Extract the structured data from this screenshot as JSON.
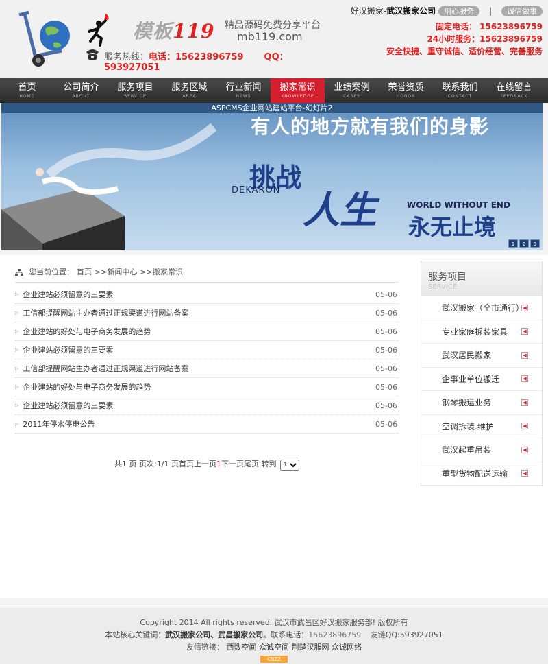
{
  "header": {
    "brand_text": "模板",
    "brand_num": "119",
    "tagline": "精品源码免费分享平台",
    "url_text": "mb119.com",
    "hotline_label": "服务热线：",
    "hotline_tel": "电话：15623896759",
    "hotline_qq": "QQ：593927051",
    "top_company_plain": "好汉搬家-",
    "top_company_bold": "武汉搬家公司",
    "pill_1": "用心服务",
    "pill_2": "诚信做事",
    "phone_fixed": "固定电话：  15623896759",
    "phone_24h": "24小时服务：15623896759",
    "motto": "安全快捷、重守诚信、适价经营、完善服务"
  },
  "nav": [
    {
      "cn": "首页",
      "en": "HOME"
    },
    {
      "cn": "公司简介",
      "en": "ABOUT"
    },
    {
      "cn": "服务项目",
      "en": "SERVICE"
    },
    {
      "cn": "服务区域",
      "en": "AREA"
    },
    {
      "cn": "行业新闻",
      "en": "NEWS"
    },
    {
      "cn": "搬家常识",
      "en": "KNOWLEDGE"
    },
    {
      "cn": "业绩案例",
      "en": "CASES"
    },
    {
      "cn": "荣誉资质",
      "en": "HONOR"
    },
    {
      "cn": "联系我们",
      "en": "CONTACT"
    },
    {
      "cn": "在线留言",
      "en": "FEEDBACK"
    }
  ],
  "banner": {
    "title": "ASPCMS企业网站建站平台-幻灯片2",
    "slogan": "有人的地方就有我们的身影",
    "tiaozhan": "挑战",
    "dekaron": "DEKARON",
    "rensheng": "人生",
    "wwe": "WORLD WITHOUT END",
    "ywzj": "永无止境",
    "dots": [
      "1",
      "2",
      "3"
    ]
  },
  "breadcrumb": {
    "label": "您当前位置：",
    "home": "首页",
    "sep1": ">>新闻中心",
    "sep2": ">>搬家常识"
  },
  "news": [
    {
      "title": "企业建站必须留意的三要素",
      "date": "05-06"
    },
    {
      "title": "工信部提醒网站主办者通过正规渠道进行网站备案",
      "date": "05-06"
    },
    {
      "title": "企业建站的好处与电子商务发展的趋势",
      "date": "05-06"
    },
    {
      "title": "企业建站必须留意的三要素",
      "date": "05-06"
    },
    {
      "title": "工信部提醒网站主办者通过正规渠道进行网站备案",
      "date": "05-06"
    },
    {
      "title": "企业建站的好处与电子商务发展的趋势",
      "date": "05-06"
    },
    {
      "title": "企业建站必须留意的三要素",
      "date": "05-06"
    },
    {
      "title": "2011年停水停电公告",
      "date": "05-06"
    }
  ],
  "pager": {
    "before": "共1 页 页次:1/1 页首页上一页",
    "current": "1",
    "after": "下一页尾页 转到",
    "select_value": "1"
  },
  "sidebar": {
    "title": "服务项目",
    "title_en": "SERVICE",
    "items": [
      "武汉搬家（全市通行）",
      "专业家庭拆装家具",
      "武汉居民搬家",
      "企事业单位搬迁",
      "钢琴搬运业务",
      "空调拆装.维护",
      "武汉起重吊装",
      "重型货物配送运输"
    ]
  },
  "footer": {
    "copyright": "Copyright 2014 All rights reserved. 武汉市武昌区好汉搬家服务部! 版权所有",
    "kw_label": "本站核心关键词：",
    "kw_values": "武汉搬家公司、武昌搬家公司",
    "tel_label": "。联系电话：",
    "tel": "15623896759",
    "qq_text": "友链QQ:593927051",
    "links_label": "友情链接：",
    "links": [
      "西数空间",
      "众诚空间",
      "荆楚汉服网",
      "众诚网络"
    ],
    "cnzz": "CNZZ"
  },
  "colors": {
    "accent_red": "#d41f2f",
    "nav_bg": "#333333"
  }
}
